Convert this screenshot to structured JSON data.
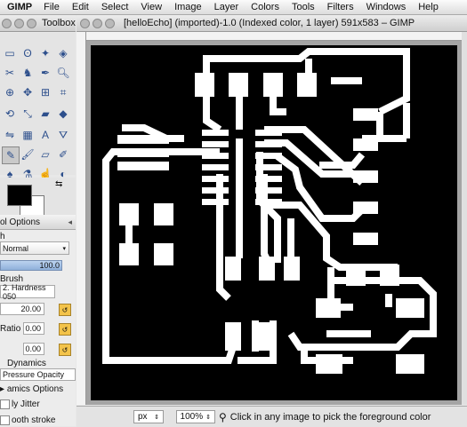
{
  "menubar": {
    "app_name": "GIMP",
    "items": [
      "File",
      "Edit",
      "Select",
      "View",
      "Image",
      "Layer",
      "Colors",
      "Tools",
      "Filters",
      "Windows",
      "Help"
    ]
  },
  "toolbox": {
    "title": "Toolbox - ..."
  },
  "tool_options": {
    "tab_label": "ol Options",
    "mode_label": "h",
    "mode_value": "Normal",
    "opacity_value": "100.0",
    "brush_label": "Brush",
    "brush_value": "2. Hardness 050",
    "size_value": "20.00",
    "ratio_label": "Ratio",
    "ratio_value": "0.00",
    "angle_value": "0.00",
    "dynamics_label": "Dynamics",
    "dynamics_value": "Pressure Opacity",
    "dynamics_options_label": "amics Options",
    "jitter_label": "ly Jitter",
    "smooth_label": "ooth stroke"
  },
  "image_window": {
    "title": "[helloEcho] (imported)-1.0 (Indexed color, 1 layer) 591x583 – GIMP"
  },
  "statusbar": {
    "unit": "px",
    "zoom": "100%",
    "message": "Click in any image to pick the foreground color"
  },
  "colors": {
    "foreground": "#000000",
    "background": "#ffffff",
    "canvas_bg": "#000000",
    "trace": "#ffffff"
  }
}
